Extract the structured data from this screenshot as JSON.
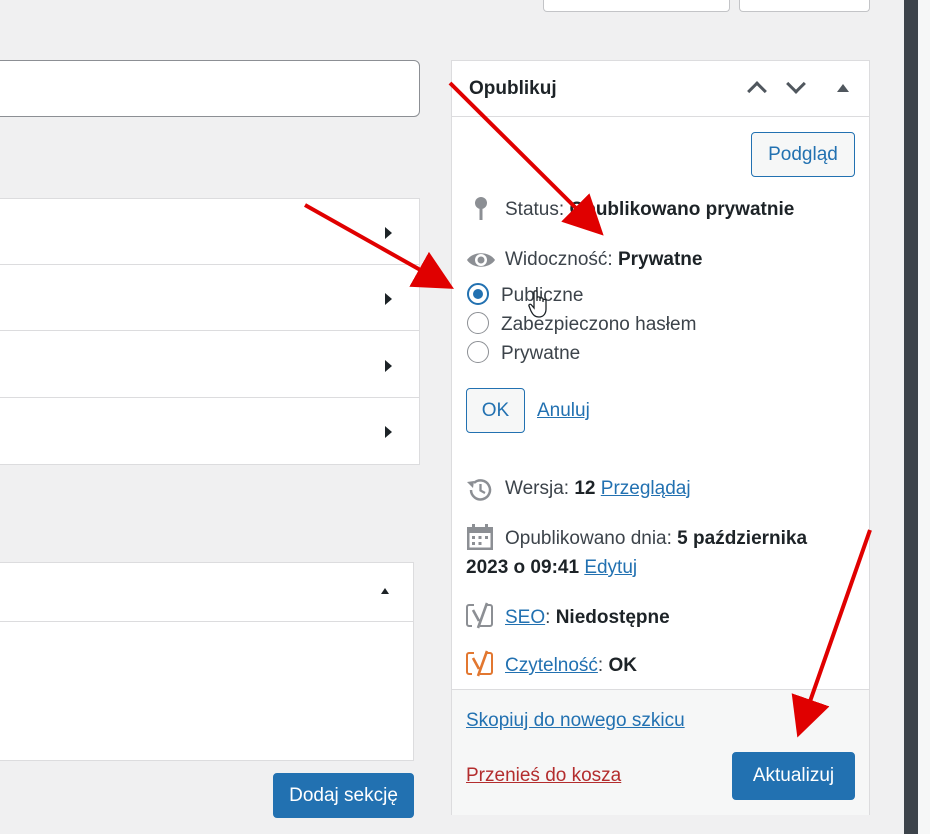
{
  "publish": {
    "title": "Opublikuj",
    "preview_label": "Podgląd",
    "status_label": "Status:",
    "status_value": "Opublikowano prywatnie",
    "visibility_label": "Widoczność:",
    "visibility_value": "Prywatne",
    "visibility_options": [
      {
        "label": "Publiczne",
        "checked": true
      },
      {
        "label": "Zabezpieczono hasłem",
        "checked": false
      },
      {
        "label": "Prywatne",
        "checked": false
      }
    ],
    "ok_label": "OK",
    "cancel_label": "Anuluj",
    "revision_label": "Wersja:",
    "revision_value": "12",
    "revision_link": "Przeglądaj",
    "published_label": "Opublikowano dnia:",
    "published_date_line1": "5 października",
    "published_date_line2": "2023 o 09:41",
    "edit_link": "Edytuj",
    "seo_link": "SEO",
    "seo_value": "Niedostępne",
    "readability_link": "Czytelność",
    "readability_value": "OK",
    "copy_draft_link": "Skopiuj do nowego szkicu",
    "trash_link": "Przenieś do kosza",
    "update_label": "Aktualizuj"
  },
  "sections": {
    "add_section_label": "Dodaj sekcję"
  },
  "colors": {
    "accent": "#2271b1",
    "danger": "#b32d2e",
    "annotation_arrow": "#e00000",
    "yoast_seo_icon": "#8c8f94",
    "yoast_readability_icon": "#e27730"
  }
}
